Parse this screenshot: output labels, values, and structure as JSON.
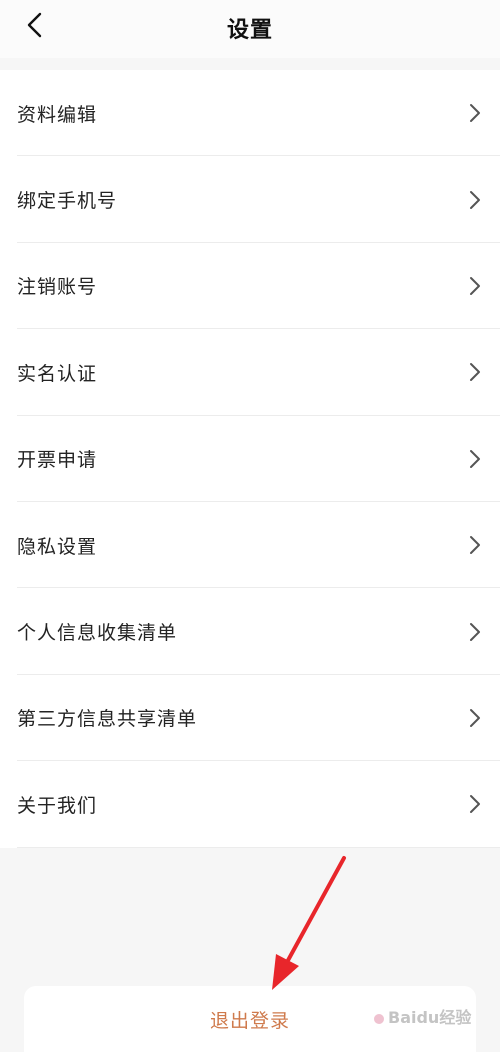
{
  "header": {
    "back_icon": "chevron-left-icon",
    "title": "设置"
  },
  "menu": {
    "items": [
      {
        "label": "资料编辑",
        "icon": "chevron-right-icon"
      },
      {
        "label": "绑定手机号",
        "icon": "chevron-right-icon"
      },
      {
        "label": "注销账号",
        "icon": "chevron-right-icon"
      },
      {
        "label": "实名认证",
        "icon": "chevron-right-icon"
      },
      {
        "label": "开票申请",
        "icon": "chevron-right-icon"
      },
      {
        "label": "隐私设置",
        "icon": "chevron-right-icon"
      },
      {
        "label": "个人信息收集清单",
        "icon": "chevron-right-icon"
      },
      {
        "label": "第三方信息共享清单",
        "icon": "chevron-right-icon"
      },
      {
        "label": "关于我们",
        "icon": "chevron-right-icon"
      }
    ]
  },
  "logout": {
    "label": "退出登录",
    "color": "#cf7a4c"
  },
  "annotation": {
    "arrow_color": "#e8262b"
  },
  "watermark": {
    "text": "Baidu经验"
  }
}
